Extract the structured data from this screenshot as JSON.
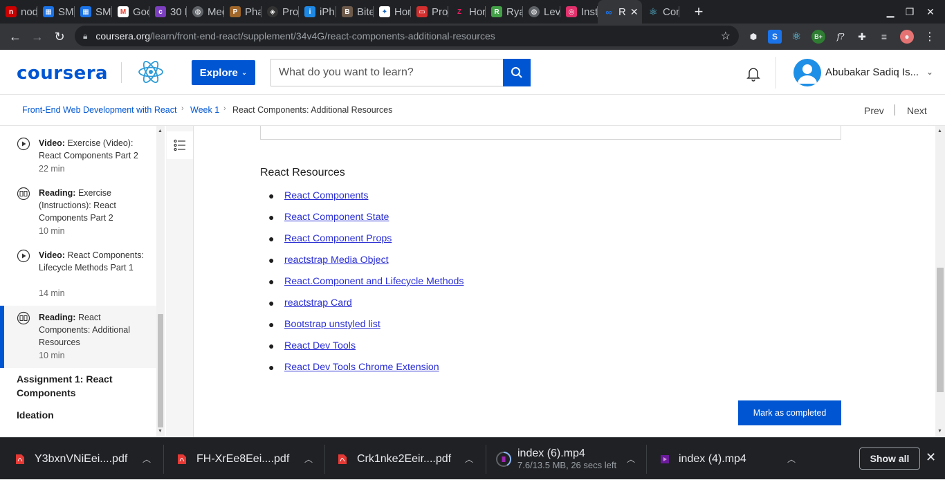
{
  "browser": {
    "tabs": [
      {
        "label": "nod",
        "color": "#c00"
      },
      {
        "label": "SMT",
        "color": "#1a73e8"
      },
      {
        "label": "SMT",
        "color": "#1a73e8"
      },
      {
        "label": "Goo",
        "color": "#ea4335"
      },
      {
        "label": "30 E",
        "color": "#7b3fbf"
      },
      {
        "label": "Med",
        "color": "#555"
      },
      {
        "label": "Pha",
        "color": "#a0662a"
      },
      {
        "label": "Pro",
        "color": "#333"
      },
      {
        "label": "iPh",
        "color": "#1e88e5"
      },
      {
        "label": "Bite",
        "color": "#555"
      },
      {
        "label": "Hor",
        "color": "#1565c0"
      },
      {
        "label": "Pro",
        "color": "#d32f2f"
      },
      {
        "label": "Hor",
        "color": "#c2185b"
      },
      {
        "label": "Rya",
        "color": "#43a047"
      },
      {
        "label": "Lev",
        "color": "#555"
      },
      {
        "label": "Inst",
        "color": "#e1306c"
      }
    ],
    "active_tab": {
      "label": "R",
      "color": "#1a73e8"
    },
    "after_tab": {
      "label": "Con",
      "color": "#61dafb"
    },
    "url_host": "coursera.org",
    "url_path": "/learn/front-end-react/supplement/34v4G/react-components-additional-resources"
  },
  "header": {
    "logo": "coursera",
    "explore_label": "Explore",
    "search_placeholder": "What do you want to learn?",
    "user_name": "Abubakar Sadiq Is..."
  },
  "breadcrumb": {
    "course": "Front-End Web Development with React",
    "week": "Week 1",
    "current": "React Components: Additional Resources",
    "prev": "Prev",
    "next": "Next"
  },
  "sidebar": {
    "items": [
      {
        "type": "Video:",
        "title": "Exercise (Video): React Components Part 2",
        "duration": "22 min",
        "icon": "play-icon"
      },
      {
        "type": "Reading:",
        "title": "Exercise (Instructions): React Components Part 2",
        "duration": "10 min",
        "icon": "book-icon"
      },
      {
        "type": "Video:",
        "title": "React Components: Lifecycle Methods Part 1",
        "duration": "14 min",
        "icon": "play-icon"
      },
      {
        "type": "Reading:",
        "title": "React Components: Additional Resources",
        "duration": "10 min",
        "icon": "book-icon"
      }
    ],
    "sections": [
      "Assignment 1: React Components",
      "Ideation"
    ]
  },
  "main": {
    "section_title": "React Resources",
    "links": [
      "React Components",
      "React Component State",
      "React Component Props",
      "reactstrap Media Object",
      "React.Component and Lifecycle Methods",
      "reactstrap Card",
      "Bootstrap unstyled list",
      "React Dev Tools",
      "React Dev Tools Chrome Extension"
    ],
    "complete_label": "Mark as completed"
  },
  "downloads": {
    "items": [
      {
        "name": "Y3bxnVNiEei....pdf"
      },
      {
        "name": "FH-XrEe8Eei....pdf"
      },
      {
        "name": "Crk1nke2Eeir....pdf"
      },
      {
        "name": "index (6).mp4",
        "status": "7.6/13.5 MB, 26 secs left"
      },
      {
        "name": "index (4).mp4"
      }
    ],
    "show_all": "Show all"
  },
  "colors": {
    "brand": "#0056d2",
    "link": "#2a2ed4",
    "chrome_dark": "#202124"
  }
}
